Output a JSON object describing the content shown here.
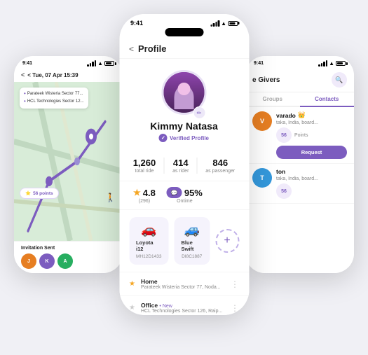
{
  "app": {
    "background": "#f0f0f5"
  },
  "left_phone": {
    "time": "9:41",
    "header": "< Tue, 07 Apr 15:39",
    "location1": "Parateek Wisteria Sector 77...",
    "location2": "HCL Technologies Sector 12...",
    "points": "56 points",
    "invitation_title": "Invitation Sent",
    "avatars": [
      {
        "label": "J",
        "color": "#e67e22"
      },
      {
        "label": "K",
        "color": "#7c5cbf"
      },
      {
        "label": "A",
        "color": "#27ae60"
      }
    ]
  },
  "center_phone": {
    "time": "9:41",
    "back_label": "<",
    "title": "Profile",
    "user_name": "Kimmy Natasa",
    "verified_text": "Verified Profile",
    "stats": [
      {
        "value": "1,260",
        "label": "total ride"
      },
      {
        "value": "414",
        "label": "as rider"
      },
      {
        "value": "846",
        "label": "as passenger"
      }
    ],
    "rating": "4.8",
    "rating_count": "(296)",
    "ontime_pct": "95%",
    "ontime_label": "Ontime",
    "cars": [
      {
        "name": "Loyota i12",
        "plate": "MH12D1433"
      },
      {
        "name": "Blue Swift",
        "plate": "DI8C1887"
      }
    ],
    "add_car_label": "+",
    "locations": [
      {
        "type": "home",
        "star": true,
        "name": "Home",
        "addr": "Parateek Wisteria Sector 77, Noda..."
      },
      {
        "type": "office",
        "star": false,
        "name": "Office",
        "tag": "• New",
        "addr": "HCL Technologies Sector 126, Raip..."
      }
    ]
  },
  "right_phone": {
    "time": "9:41",
    "title": "e Givers",
    "search_icon": "🔍",
    "tabs": [
      {
        "label": "roups",
        "active": false
      },
      {
        "label": "Contacts",
        "active": true
      }
    ],
    "givers": [
      {
        "name": "varado",
        "avatar_letter": "V",
        "avatar_color": "#e67e22",
        "crown": true,
        "loc1": "taka, India,",
        "loc2": "board...",
        "points": "56",
        "points_label": "Points",
        "has_request": true,
        "request_label": "Request"
      },
      {
        "name": "ton",
        "avatar_letter": "T",
        "avatar_color": "#3498db",
        "crown": false,
        "loc1": "taka, India,",
        "loc2": "board...",
        "points": "56",
        "points_label": "",
        "has_request": false
      }
    ]
  }
}
